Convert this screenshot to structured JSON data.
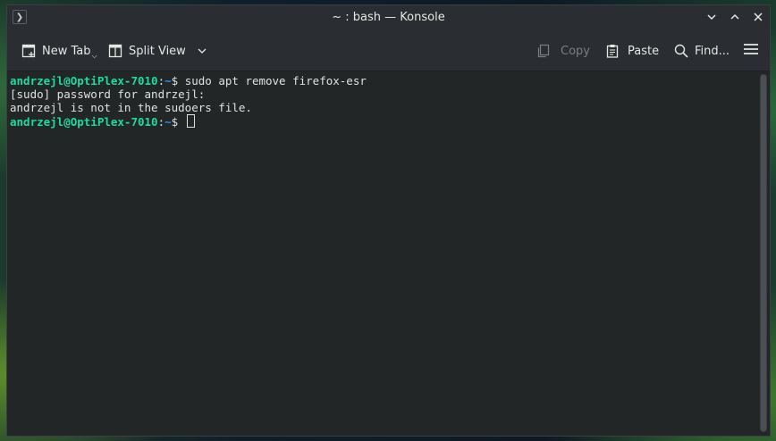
{
  "window": {
    "title": "~ : bash — Konsole"
  },
  "toolbar": {
    "new_tab": "New Tab",
    "split_view": "Split View",
    "copy": "Copy",
    "paste": "Paste",
    "find": "Find..."
  },
  "terminal": {
    "lines": [
      {
        "user": "andrzejl@OptiPlex-7010",
        "sep": ":",
        "path": "~",
        "cmd": "$ sudo apt remove firefox-esr"
      },
      {
        "text": "[sudo] password for andrzejl:"
      },
      {
        "text": "andrzejl is not in the sudoers file."
      },
      {
        "user": "andrzejl@OptiPlex-7010",
        "sep": ":",
        "path": "~",
        "cmd": "$ "
      }
    ]
  },
  "colors": {
    "prompt_user": "#1cdc9a",
    "prompt_path": "#1d99f3",
    "terminal_bg": "#232627"
  }
}
